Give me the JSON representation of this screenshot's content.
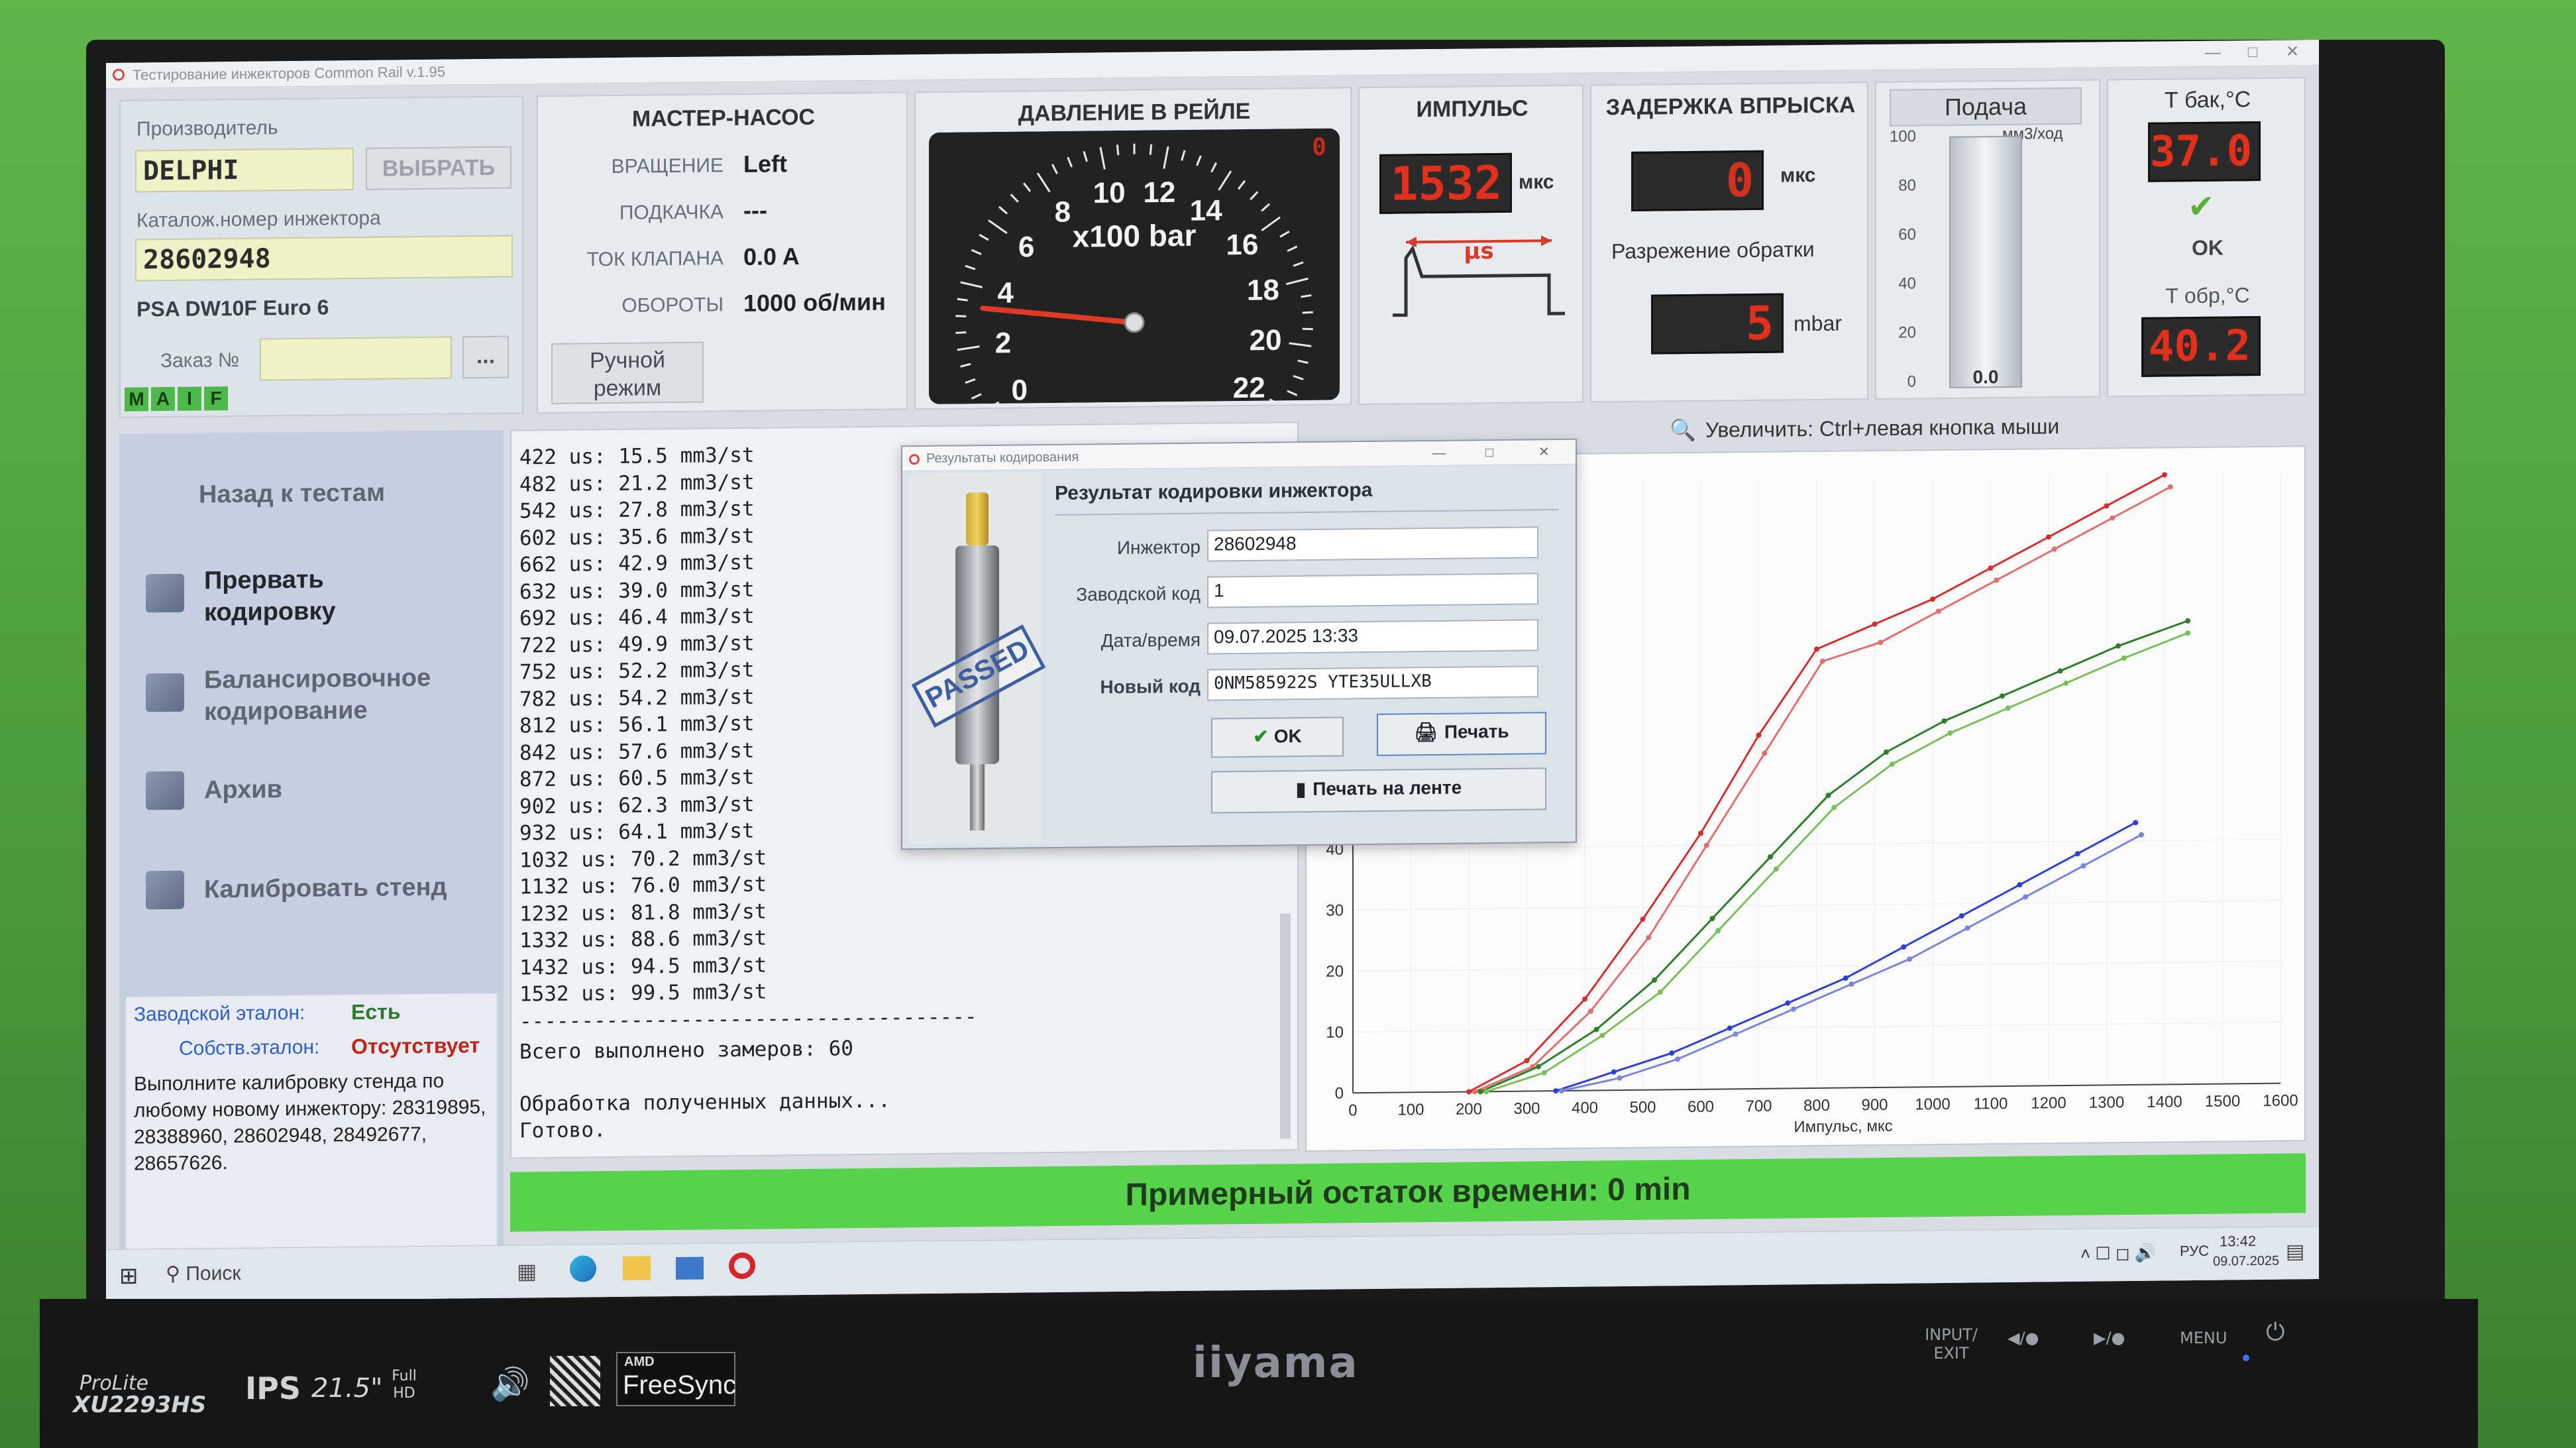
{
  "window": {
    "title": "Тестирование инжекторов Common Rail v.1.95"
  },
  "manufacturer": {
    "label": "Производитель",
    "value": "DELPHI",
    "select_button": "ВЫБРАТЬ",
    "catalog_label": "Каталож.номер инжектора",
    "catalog_value": "28602948",
    "engine": "PSA  DW10F Euro 6",
    "order_label": "Заказ №",
    "order_value": "",
    "order_button": "...",
    "tags": [
      "M",
      "A",
      "I",
      "F"
    ]
  },
  "pump": {
    "title": "МАСТЕР-НАСОС",
    "rows": [
      {
        "label": "ВРАЩЕНИЕ",
        "value": "Left"
      },
      {
        "label": "ПОДКАЧКА",
        "value": "---"
      },
      {
        "label": "ТОК КЛАПАНА",
        "value": "0.0 A"
      },
      {
        "label": "ОБОРОТЫ",
        "value": "1000 об/мин"
      }
    ],
    "manual_button": "Ручной режим"
  },
  "pressure": {
    "title": "ДАВЛЕНИЕ В РЕЙЛЕ",
    "unit": "x100 bar",
    "value_readout": "0",
    "ticks": [
      "0",
      "2",
      "4",
      "6",
      "8",
      "10",
      "12",
      "14",
      "16",
      "18",
      "20",
      "22"
    ],
    "needle_value": 3.3
  },
  "impulse": {
    "title": "ИМПУЛЬС",
    "value": "1532",
    "unit": "мкс",
    "diagram_label": "µs"
  },
  "delay": {
    "title": "ЗАДЕРЖКА ВПРЫСКА",
    "value": "0",
    "unit": "мкс",
    "return_label": "Разрежение обратки",
    "return_value": "5",
    "return_unit": "mbar"
  },
  "feed": {
    "title": "Подача",
    "unit": "мм3/ход",
    "scale": [
      "100",
      "80",
      "60",
      "40",
      "20",
      "0"
    ],
    "value": "0.0",
    "level": 0
  },
  "temps": {
    "tank_label": "Т бак,°С",
    "tank_value": "37.0",
    "status": "OK",
    "return_label": "Т обр,°С",
    "return_value": "40.2"
  },
  "menu": {
    "back": "Назад к тестам",
    "items": [
      {
        "label": "Прервать кодировку",
        "icon": "calculator-icon"
      },
      {
        "label": "Балансировочное кодирование",
        "icon": "chart-icon"
      },
      {
        "label": "Архив",
        "icon": "archive-icon"
      },
      {
        "label": "Калибровать стенд",
        "icon": "gears-icon"
      }
    ],
    "factory_ref_label": "Заводской эталон:",
    "factory_ref_value": "Есть",
    "own_ref_label": "Собств.эталон:",
    "own_ref_value": "Отсутствует",
    "note": "Выполните калибровку стенда по любому новому инжектору: 28319895, 28388960, 28602948, 28492677, 28657626."
  },
  "log": {
    "lines": [
      "422 us: 15.5 mm3/st",
      "482 us: 21.2 mm3/st",
      "542 us: 27.8 mm3/st",
      "602 us: 35.6 mm3/st",
      "662 us: 42.9 mm3/st",
      "632 us: 39.0 mm3/st",
      "692 us: 46.4 mm3/st",
      "722 us: 49.9 mm3/st",
      "752 us: 52.2 mm3/st",
      "782 us: 54.2 mm3/st",
      "812 us: 56.1 mm3/st",
      "842 us: 57.6 mm3/st",
      "872 us: 60.5 mm3/st",
      "902 us: 62.3 mm3/st",
      "932 us: 64.1 mm3/st",
      "1032 us: 70.2 mm3/st",
      "1132 us: 76.0 mm3/st",
      "1232 us: 81.8 mm3/st",
      "1332 us: 88.6 mm3/st",
      "1432 us: 94.5 mm3/st",
      "1532 us: 99.5 mm3/st"
    ],
    "separator": "-------------------------------------",
    "total": "Всего выполнено замеров: 60",
    "processing": "Обработка полученных данных...",
    "done": "Готово."
  },
  "dialog": {
    "title": "Результаты кодирования",
    "heading": "Результат кодировки инжектора",
    "stamp": "PASSED",
    "fields": [
      {
        "label": "Инжектор",
        "value": "28602948"
      },
      {
        "label": "Заводской код",
        "value": "1"
      },
      {
        "label": "Дата/время",
        "value": "09.07.2025 13:33"
      },
      {
        "label": "Новый код",
        "value": "0NM585922S YTE35ULLXB"
      }
    ],
    "ok_button": "OK",
    "print_button": "Печать",
    "tape_button": "Печать на ленте"
  },
  "chart_hint": "Увеличить: Ctrl+левая кнопка мыши",
  "chart_data": {
    "type": "line",
    "xlabel": "Импульс, мкс",
    "ylabel": "",
    "xlim": [
      0,
      1600
    ],
    "ylim": [
      0,
      100
    ],
    "x_ticks": [
      "0",
      "100",
      "200",
      "300",
      "400",
      "500",
      "600",
      "700",
      "800",
      "900",
      "1000",
      "1100",
      "1200",
      "1300",
      "1400",
      "1500",
      "1600"
    ],
    "y_ticks": [
      "0",
      "10",
      "20",
      "30",
      "40"
    ],
    "grid": true,
    "series": [
      {
        "color": "#d23030",
        "x": [
          200,
          300,
          400,
          500,
          600,
          700,
          800,
          900,
          1000,
          1100,
          1200,
          1300,
          1400
        ],
        "y": [
          0,
          5,
          15,
          28,
          42,
          58,
          72,
          76,
          80,
          85,
          90,
          95,
          100
        ]
      },
      {
        "color": "#e07070",
        "x": [
          210,
          310,
          410,
          510,
          610,
          710,
          810,
          910,
          1010,
          1110,
          1210,
          1310,
          1410
        ],
        "y": [
          0,
          4,
          13,
          25,
          40,
          55,
          70,
          73,
          78,
          83,
          88,
          93,
          98
        ]
      },
      {
        "color": "#2f7d2f",
        "x": [
          220,
          320,
          420,
          520,
          620,
          720,
          820,
          920,
          1020,
          1120,
          1220,
          1320,
          1440
        ],
        "y": [
          0,
          4,
          10,
          18,
          28,
          38,
          48,
          55,
          60,
          64,
          68,
          72,
          76
        ]
      },
      {
        "color": "#7bbf5c",
        "x": [
          230,
          330,
          430,
          530,
          630,
          730,
          830,
          930,
          1030,
          1130,
          1230,
          1330,
          1440
        ],
        "y": [
          0,
          3,
          9,
          16,
          26,
          36,
          46,
          53,
          58,
          62,
          66,
          70,
          74
        ]
      },
      {
        "color": "#2f3fd6",
        "x": [
          350,
          450,
          550,
          650,
          750,
          850,
          950,
          1050,
          1150,
          1250,
          1350
        ],
        "y": [
          0,
          3,
          6,
          10,
          14,
          18,
          23,
          28,
          33,
          38,
          43
        ]
      },
      {
        "color": "#7a86d8",
        "x": [
          360,
          460,
          560,
          660,
          760,
          860,
          960,
          1060,
          1160,
          1260,
          1360
        ],
        "y": [
          0,
          2,
          5,
          9,
          13,
          17,
          21,
          26,
          31,
          36,
          41
        ]
      }
    ]
  },
  "status": "Примерный остаток времени: 0 min",
  "taskbar": {
    "search": "Поиск",
    "lang": "РУС",
    "time": "13:42",
    "date": "09.07.2025"
  },
  "monitor": {
    "brand": "iiyama",
    "model_line1": "ProLite",
    "model_line2": "XU2293HS",
    "panel": "IPS",
    "size": "21.5\"",
    "fullhd": "Full HD",
    "freesync_top": "AMD",
    "freesync": "FreeSync",
    "btn_input": "INPUT/ EXIT",
    "btn_menu": "MENU"
  }
}
